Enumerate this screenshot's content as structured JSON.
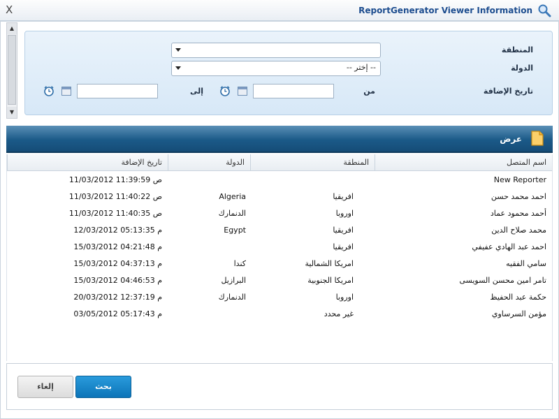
{
  "window": {
    "title": "ReportGenerator Viewer Information",
    "close_glyph": "X"
  },
  "filters": {
    "region_label": "المنطقة",
    "region_value": "",
    "country_label": "الدولة",
    "country_value": "-- إختر --",
    "date_label": "تاريخ الإضافة",
    "from_label": "من",
    "to_label": "إلى",
    "from_value": "",
    "to_value": ""
  },
  "results": {
    "title": "عرض",
    "columns": [
      "اسم المتصل",
      "المنطقة",
      "الدولة",
      "تاريخ الإضافة"
    ],
    "rows": [
      {
        "name": "New Reporter",
        "region": "",
        "country": "",
        "date": "11/03/2012 11:39:59 ص"
      },
      {
        "name": "احمد محمد حسن",
        "region": "افريقيا",
        "country": "Algeria",
        "date": "11/03/2012 11:40:22 ص"
      },
      {
        "name": "أحمد محمود عماد",
        "region": "اوروبا",
        "country": "الدنمارك",
        "date": "11/03/2012 11:40:35 ص"
      },
      {
        "name": "محمد صلاح الدين",
        "region": "افريقيا",
        "country": "Egypt",
        "date": "12/03/2012 05:13:35 م"
      },
      {
        "name": "احمد عبد الهادي عفيفي",
        "region": "افريقيا",
        "country": "",
        "date": "15/03/2012 04:21:48 م"
      },
      {
        "name": "سامي الفقيه",
        "region": "امريكا الشمالية",
        "country": "كندا",
        "date": "15/03/2012 04:37:13 م"
      },
      {
        "name": "تامر امين محسن السويسى",
        "region": "امريكا الجنوبية",
        "country": "البرازيل",
        "date": "15/03/2012 04:46:53 م"
      },
      {
        "name": "حكمة عبد الحفيظ",
        "region": "اوروبا",
        "country": "الدنمارك",
        "date": "20/03/2012 12:37:19 م"
      },
      {
        "name": "مؤمن السرساوي",
        "region": "غير محدد",
        "country": "",
        "date": "03/05/2012 05:17:43 م"
      }
    ]
  },
  "buttons": {
    "search": "بحث",
    "cancel": "إلغاء"
  },
  "colors": {
    "accent": "#0c74b8",
    "header": "#1b5a88",
    "panel": "#d7e8f7"
  }
}
